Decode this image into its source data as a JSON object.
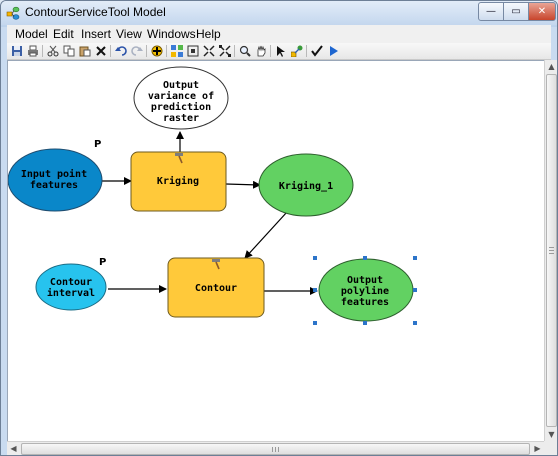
{
  "window": {
    "title": "ContourServiceTool Model",
    "minimize_glyph": "—",
    "maximize_glyph": "▭",
    "close_glyph": "✕"
  },
  "menu": {
    "items": [
      "Model",
      "Edit",
      "Insert",
      "View",
      "Windows",
      "Help"
    ]
  },
  "toolbar": {
    "buttons": [
      "save-icon",
      "print-icon",
      "cut-icon",
      "copy-icon",
      "paste-icon",
      "delete-icon",
      "undo-icon",
      "redo-icon",
      "add-data-icon",
      "auto-layout-icon",
      "full-extent-icon",
      "zoom-fixed-in-icon",
      "zoom-fixed-out-icon",
      "zoom-in-icon",
      "pan-icon",
      "select-icon",
      "connect-icon",
      "validate-icon",
      "run-icon"
    ]
  },
  "colors": {
    "input_data": "#0a87c9",
    "input_value": "#27c3ee",
    "tool": "#ffc93a",
    "derived_data": "#62d162",
    "output_ellipse": "#ffffff",
    "selection_handle": "#2c74c9"
  },
  "diagram": {
    "nodes": {
      "input_point_features": {
        "lines": [
          "Input point",
          "features"
        ],
        "param_marker": "P"
      },
      "kriging": {
        "lines": [
          "Kriging"
        ]
      },
      "output_variance": {
        "lines": [
          "Output",
          "variance of",
          "prediction",
          "raster"
        ]
      },
      "kriging_1": {
        "lines": [
          "Kriging_1"
        ]
      },
      "contour_interval": {
        "lines": [
          "Contour",
          "interval"
        ],
        "param_marker": "P"
      },
      "contour": {
        "lines": [
          "Contour"
        ]
      },
      "output_polyline": {
        "lines": [
          "Output",
          "polyline",
          "features"
        ]
      }
    }
  },
  "scrollbars": {
    "up": "▲",
    "down": "▼",
    "left": "◀",
    "right": "▶"
  }
}
